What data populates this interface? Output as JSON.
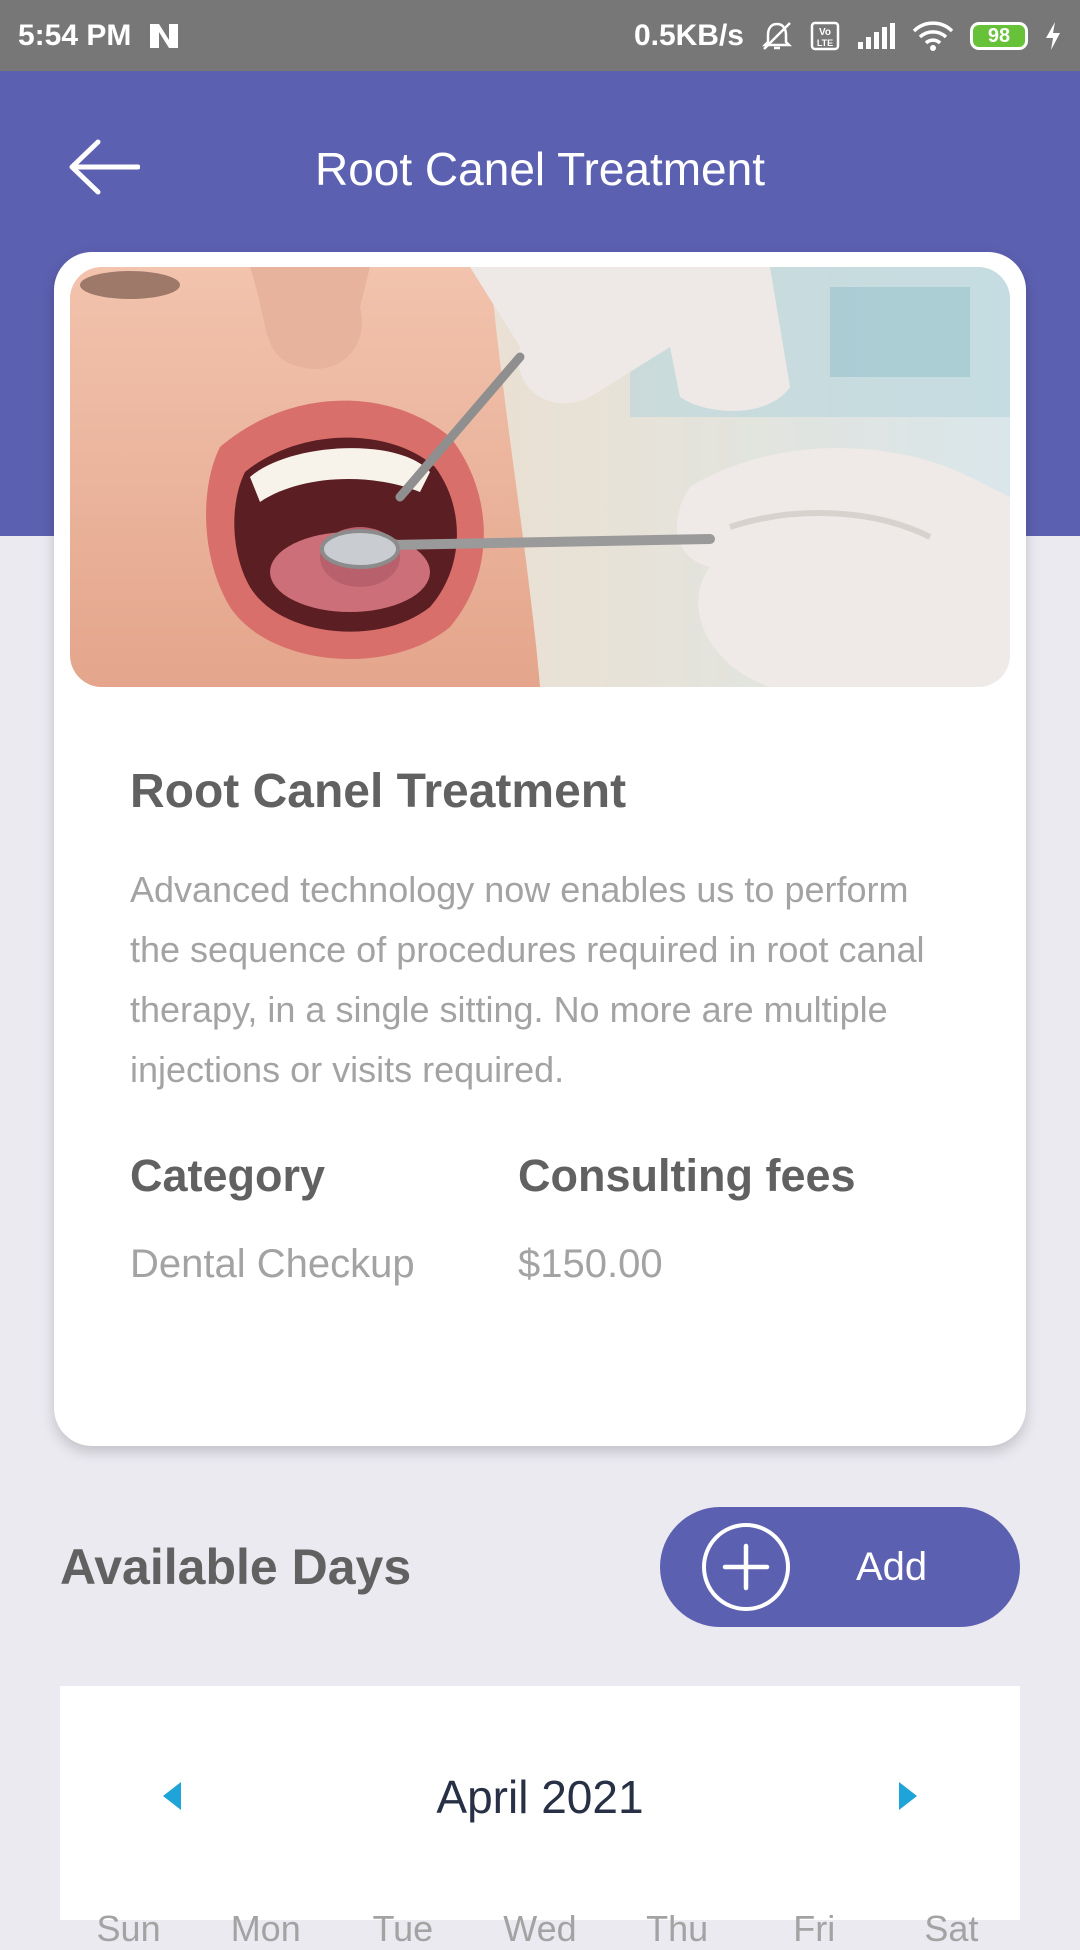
{
  "status_bar": {
    "time": "5:54 PM",
    "network_speed": "0.5KB/s",
    "battery_level": "98",
    "icons": [
      "n-logo-icon",
      "mute-icon",
      "volte-icon",
      "signal-icon",
      "wifi-icon",
      "battery-icon",
      "charging-icon"
    ]
  },
  "header": {
    "title": "Root Canel Treatment",
    "back_icon": "arrow-left-icon",
    "color": "#5c60b0"
  },
  "service": {
    "image_alt": "dentist examining open mouth with mirror and probe",
    "title": "Root Canel Treatment",
    "description": "Advanced technology now enables us to perform the sequence of procedures required in root canal therapy, in a single sitting. No more are multiple injections or visits required.",
    "category_label": "Category",
    "category_value": "Dental Checkup",
    "fees_label": "Consulting fees",
    "fees_value": "$150.00"
  },
  "availability": {
    "title": "Available Days",
    "add_label": "Add",
    "add_icon": "plus-circle-icon"
  },
  "calendar": {
    "month": "April 2021",
    "prev_icon": "triangle-left-icon",
    "next_icon": "triangle-right-icon",
    "accent": "#1ea4d8",
    "weekdays": [
      "Sun",
      "Mon",
      "Tue",
      "Wed",
      "Thu",
      "Fri",
      "Sat"
    ]
  }
}
